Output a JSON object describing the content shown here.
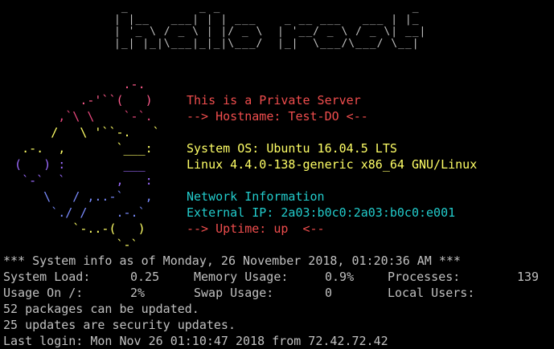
{
  "banner_lines": [
    " _          _ _                           _",
    "| |__   ___| | | ___    _ __ ___   ___ | |_",
    "| '_ \\ / _ \\ | |/ _ \\  | '__/ _ \\ / _ \\| __|",
    "|_| |_|\\___|_|_|\\___/  |_|  \\___/\\___/ \\__|"
  ],
  "logo_lines": [
    "                 .-.",
    "           .-'``(   )",
    "        ,`\\ \\    `-`.",
    "       /   \\ '``-.   `",
    "   .-.  ,       `___:",
    "  (   ) :        ___",
    "   `-`  `       ,   :",
    "      \\   / ,..-`   ,",
    "       `./ /    .-.`",
    "          `-..-(   )",
    "                `-`"
  ],
  "info": {
    "private": "This is a Private Server",
    "hostname": "--> Hostname: Test-DO <--",
    "system_os": "System OS: Ubuntu 16.04.5 LTS",
    "kernel": "Linux 4.4.0-138-generic x86_64 GNU/Linux",
    "network_info": "Network Information",
    "external_ip_label": "External IP: ",
    "external_ip_value": "2a03:b0c0:2a03:b0c0:e001",
    "uptime": "--> Uptime: up  <--"
  },
  "sysinfo": {
    "header": "*** System info as of Monday, 26 November 2018, 01:20:36 AM ***",
    "system_load_label": "System Load:",
    "system_load_value": "0.25",
    "memory_usage_label": "Memory Usage:",
    "memory_usage_value": "0.9%",
    "processes_label": "Processes:",
    "processes_value": "139",
    "usage_on_label": "Usage On /:",
    "usage_on_value": "2%",
    "swap_usage_label": "Swap Usage:",
    "swap_usage_value": "0",
    "local_users_label": "Local Users:",
    "local_users_value": "",
    "packages": "52 packages can be updated.",
    "security": "25 updates are security updates.",
    "last_login": "Last login: Mon Nov 26 01:10:47 2018 from 72.42.72.42"
  },
  "colors": {
    "background": "#000000",
    "default_text": "#c0c0c0",
    "red": "#ef4d4d",
    "yellow": "#ffff66",
    "cyan": "#22cccc",
    "pink": "#ff5b8c",
    "purple": "#9c6bff"
  }
}
